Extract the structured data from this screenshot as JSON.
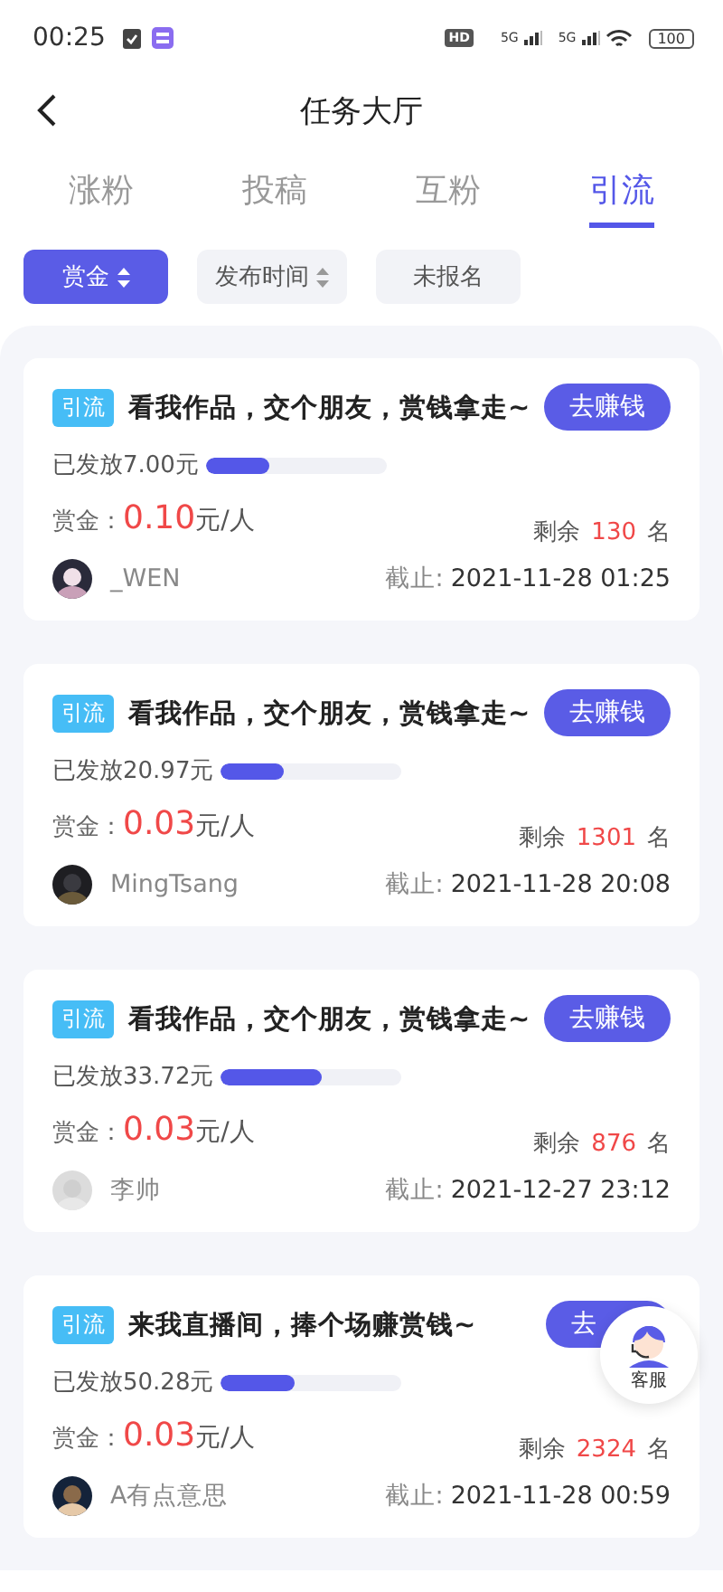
{
  "status_bar": {
    "time": "00:25",
    "hd": "HD",
    "networks": [
      "5G",
      "5G"
    ],
    "battery": "100"
  },
  "header": {
    "title": "任务大厅"
  },
  "tabs": [
    {
      "label": "涨粉",
      "selected": false
    },
    {
      "label": "投稿",
      "selected": false
    },
    {
      "label": "互粉",
      "selected": false
    },
    {
      "label": "引流",
      "selected": true
    }
  ],
  "filters": [
    {
      "label": "赏金",
      "selected": true,
      "sortable": true
    },
    {
      "label": "发布时间",
      "selected": false,
      "sortable": true
    },
    {
      "label": "未报名",
      "selected": false,
      "sortable": false
    }
  ],
  "tasks": [
    {
      "tag": "引流",
      "title": "看我作品，交个朋友，赏钱拿走~",
      "action": "去赚钱",
      "paid": "已发放7.00元",
      "level": 0.35,
      "reward_label": "赏金：",
      "reward": "0.10",
      "unit": "元/人",
      "remaining_label": "剩余",
      "remaining": "130",
      "remaining_unit": "名",
      "user": "_WEN",
      "deadline_label": "截止:",
      "deadline": "2021-11-28 01:25"
    },
    {
      "tag": "引流",
      "title": "看我作品，交个朋友，赏钱拿走~",
      "action": "去赚钱",
      "paid": "已发放20.97元",
      "level": 0.35,
      "reward_label": "赏金：",
      "reward": "0.03",
      "unit": "元/人",
      "remaining_label": "剩余",
      "remaining": "1301",
      "remaining_unit": "名",
      "user": "MingTsang",
      "deadline_label": "截止:",
      "deadline": "2021-11-28 20:08"
    },
    {
      "tag": "引流",
      "title": "看我作品，交个朋友，赏钱拿走~",
      "action": "去赚钱",
      "paid": "已发放33.72元",
      "level": 0.56,
      "reward_label": "赏金：",
      "reward": "0.03",
      "unit": "元/人",
      "remaining_label": "剩余",
      "remaining": "876",
      "remaining_unit": "名",
      "user": "李帅",
      "deadline_label": "截止:",
      "deadline": "2021-12-27 23:12"
    },
    {
      "tag": "引流",
      "title": "来我直播间，捧个场赚赏钱~",
      "action": "去",
      "paid": "已发放50.28元",
      "level": 0.41,
      "reward_label": "赏金：",
      "reward": "0.03",
      "unit": "元/人",
      "remaining_label": "剩余",
      "remaining": "2324",
      "remaining_unit": "名",
      "user": "A有点意思",
      "deadline_label": "截止:",
      "deadline": "2021-11-28 00:59"
    }
  ],
  "support": {
    "label": "客服"
  }
}
